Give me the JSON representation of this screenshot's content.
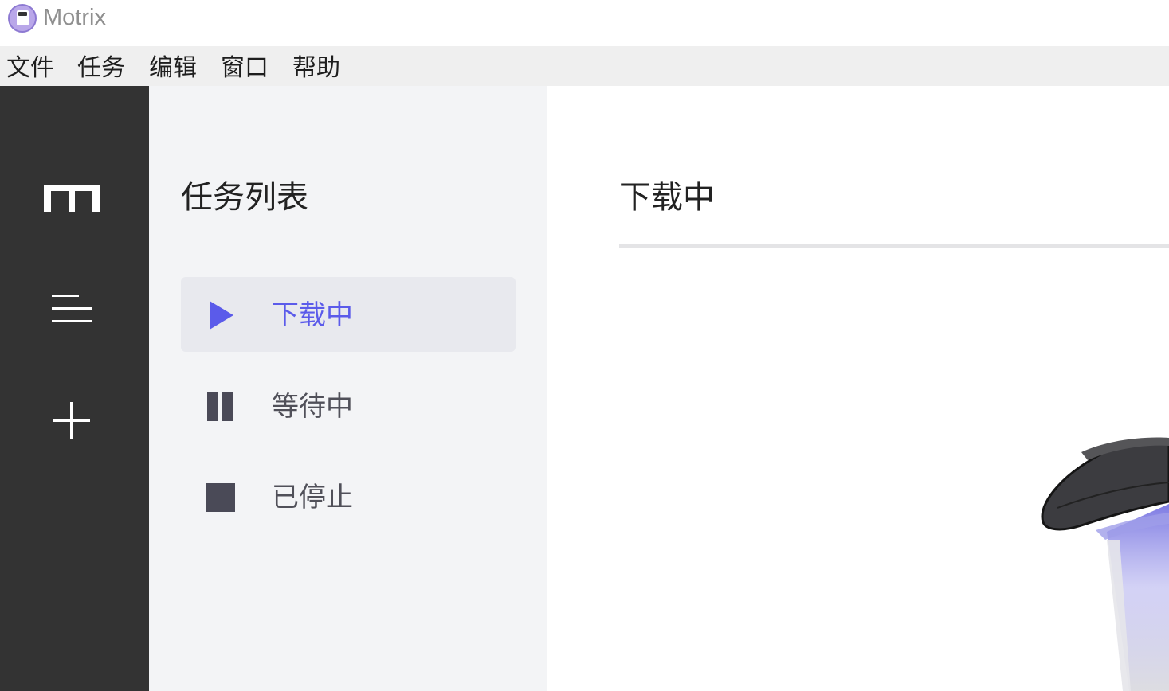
{
  "app": {
    "title": "Motrix"
  },
  "menubar": {
    "items": [
      "文件",
      "任务",
      "编辑",
      "窗口",
      "帮助"
    ]
  },
  "sidebar": {
    "icons": [
      "motrix-logo-icon",
      "task-list-icon",
      "add-task-icon"
    ]
  },
  "task_panel": {
    "title": "任务列表",
    "items": [
      {
        "label": "下载中",
        "icon": "play-icon",
        "active": true
      },
      {
        "label": "等待中",
        "icon": "pause-icon",
        "active": false
      },
      {
        "label": "已停止",
        "icon": "stop-icon",
        "active": false
      }
    ]
  },
  "main": {
    "title": "下载中"
  },
  "colors": {
    "accent": "#5b5bea",
    "sidebar_bg": "#333333",
    "panel_bg": "#f3f4f6",
    "menubar_bg": "#efefef"
  }
}
